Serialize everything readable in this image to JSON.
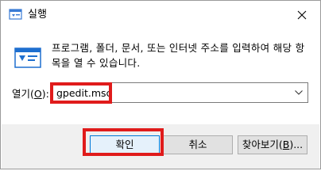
{
  "window": {
    "title": "실행",
    "close_icon": "close-icon"
  },
  "description": "프로그램, 폴더, 문서, 또는 인터넷 주소를 입력하여 해당 항목을 열 수 있습니다.",
  "open_field": {
    "label_prefix": "열기(",
    "label_accesskey": "O",
    "label_suffix": "):",
    "value": "gpedit.msc"
  },
  "buttons": {
    "ok": "확인",
    "cancel": "취소",
    "browse_prefix": "찾아보기(",
    "browse_accesskey": "B",
    "browse_suffix": ")..."
  },
  "colors": {
    "highlight": "#e01b1b",
    "ok_border": "#0078d7"
  }
}
